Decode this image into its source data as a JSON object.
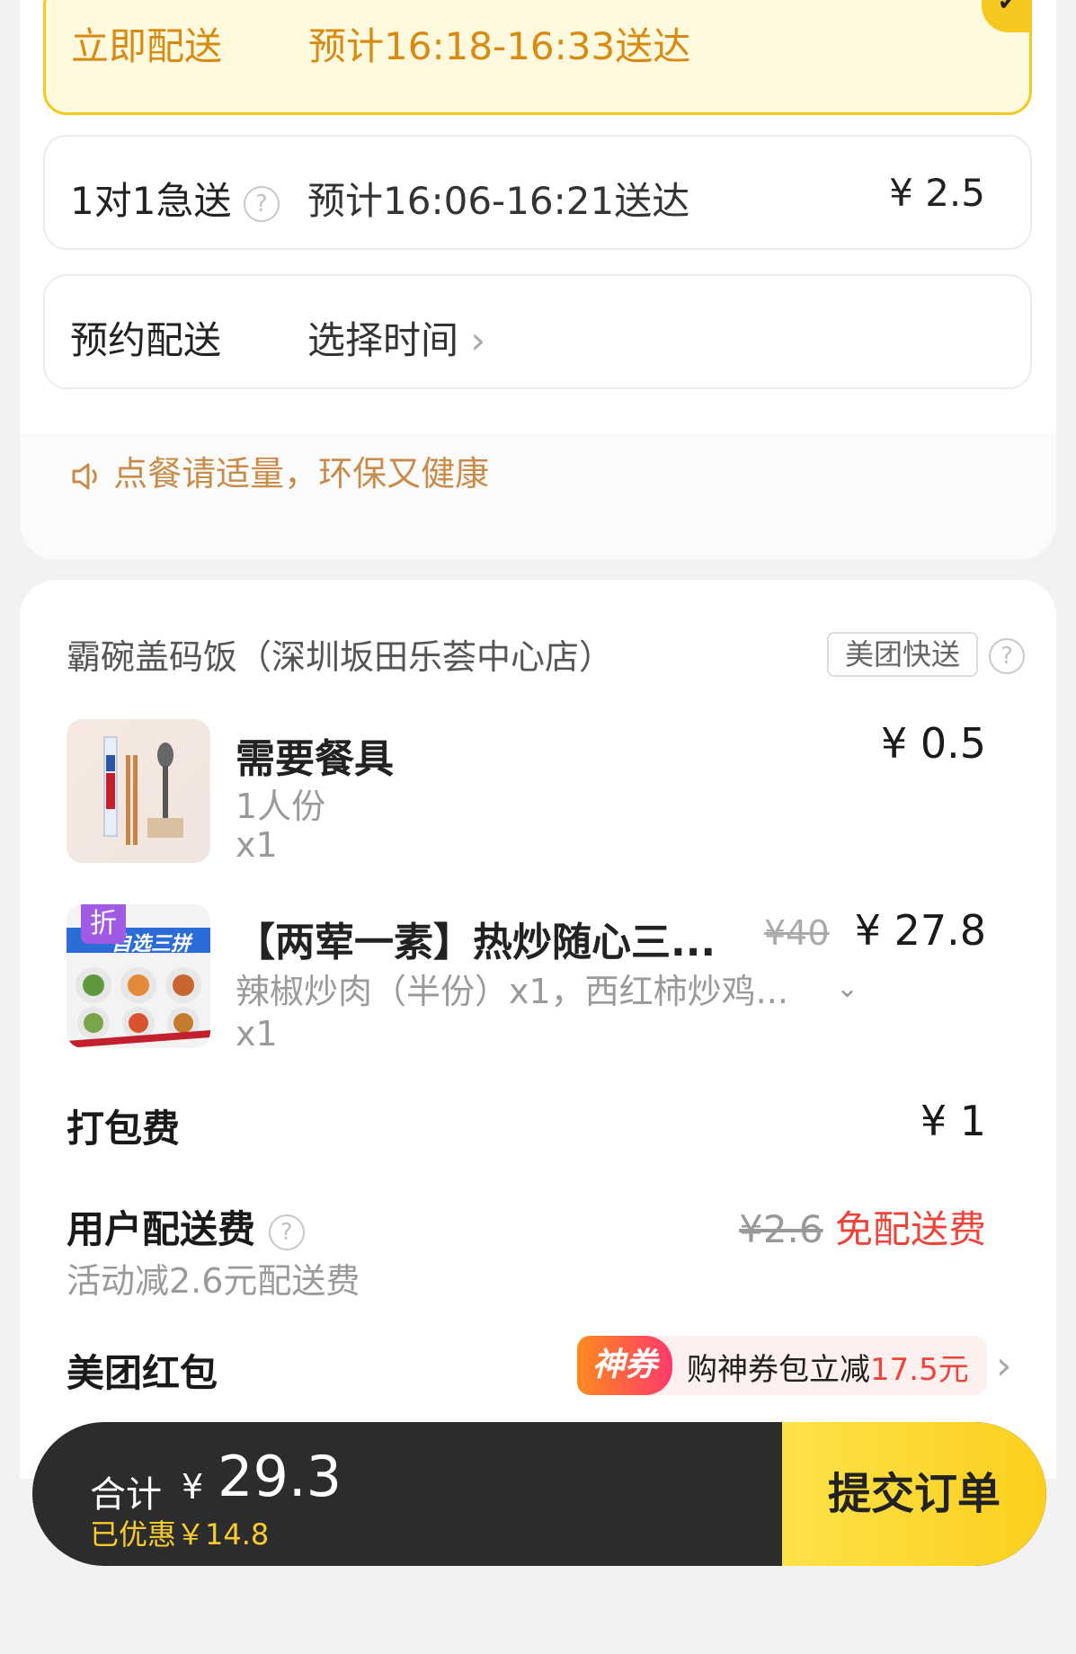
{
  "delivery": {
    "instant": {
      "label": "立即配送",
      "eta": "预计16:18-16:33送达",
      "check": "✔"
    },
    "express": {
      "label": "1对1急送",
      "help": "?",
      "eta": "预计16:06-16:21送达",
      "price": "¥ 2.5"
    },
    "scheduled": {
      "label": "预约配送",
      "action": "选择时间",
      "chevron": "›"
    }
  },
  "notice": {
    "icon": "speaker-icon",
    "text": "点餐请适量，环保又健康"
  },
  "order": {
    "store_name": "霸碗盖码饭（深圳坂田乐荟中心店）",
    "ship_tag": "美团快送",
    "ship_help": "?",
    "items": [
      {
        "name": "需要餐具",
        "spec": "1人份",
        "qty": "x1",
        "price": "¥ 0.5"
      },
      {
        "name": "【两荤一素】热炒随心三...",
        "spec": "辣椒炒肉（半份）x1，西红柿炒鸡...",
        "qty": "x1",
        "old_price": "¥40",
        "price": "¥ 27.8",
        "badge": "折",
        "thumb_text": "自选三拼"
      }
    ],
    "packing": {
      "label": "打包费",
      "price": "¥ 1"
    },
    "delivery_fee": {
      "label": "用户配送费",
      "help": "?",
      "old_price": "¥2.6",
      "free_label": "免配送费",
      "note": "活动减2.6元配送费"
    },
    "red_packet": {
      "label": "美团红包",
      "badge": "神券",
      "promo_prefix": "购神券包立减",
      "promo_amount": "17.5元",
      "chevron": "›"
    }
  },
  "bottom": {
    "total_label": "合计",
    "currency": "¥",
    "total": "29.3",
    "saved": "已优惠￥14.8",
    "submit": "提交订单"
  },
  "colors": {
    "accent_yellow": "#f5c81f",
    "orange_text": "#d98a12",
    "red": "#f0443a",
    "dark_bar": "#2c2c2c"
  }
}
